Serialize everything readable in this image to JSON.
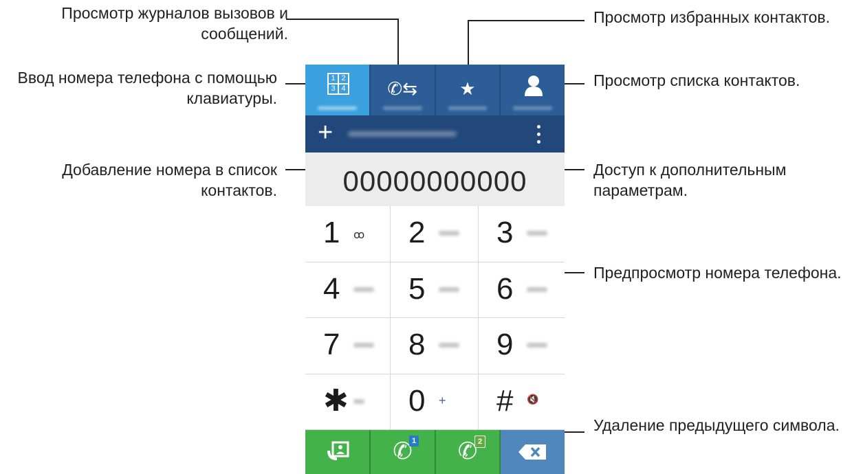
{
  "annotations": {
    "logs": "Просмотр журналов вызовов и сообщений.",
    "keypad": "Ввод номера телефона с помощью клавиатуры.",
    "add_contact": "Добавление номера в список контактов.",
    "favorites": "Просмотр избранных контактов.",
    "contacts": "Просмотр списка контактов.",
    "options": "Доступ к дополнительным параметрам.",
    "preview": "Предпросмотр номера телефона.",
    "delete": "Удаление предыдущего символа."
  },
  "tabs": [
    {
      "icon": "keypad-icon",
      "active": true
    },
    {
      "icon": "call-log-icon",
      "active": false
    },
    {
      "icon": "star-icon",
      "active": false
    },
    {
      "icon": "contact-icon",
      "active": false
    }
  ],
  "actionbar": {
    "plus_label": "+"
  },
  "display": {
    "number": "00000000000"
  },
  "keys": [
    {
      "digit": "1",
      "sub": "∞"
    },
    {
      "digit": "2",
      "sub": ""
    },
    {
      "digit": "3",
      "sub": ""
    },
    {
      "digit": "4",
      "sub": ""
    },
    {
      "digit": "5",
      "sub": ""
    },
    {
      "digit": "6",
      "sub": ""
    },
    {
      "digit": "7",
      "sub": ""
    },
    {
      "digit": "8",
      "sub": ""
    },
    {
      "digit": "9",
      "sub": ""
    },
    {
      "digit": "✱",
      "sub": ""
    },
    {
      "digit": "0",
      "sub": "+"
    },
    {
      "digit": "#",
      "sub": "🔇"
    }
  ],
  "bottom": {
    "sim1": "1",
    "sim2": "2"
  },
  "colors": {
    "tab_active": "#3aa1de",
    "tab": "#2c5d97",
    "actionbar": "#22477a",
    "call": "#44b24a",
    "delete": "#4f86bc"
  }
}
